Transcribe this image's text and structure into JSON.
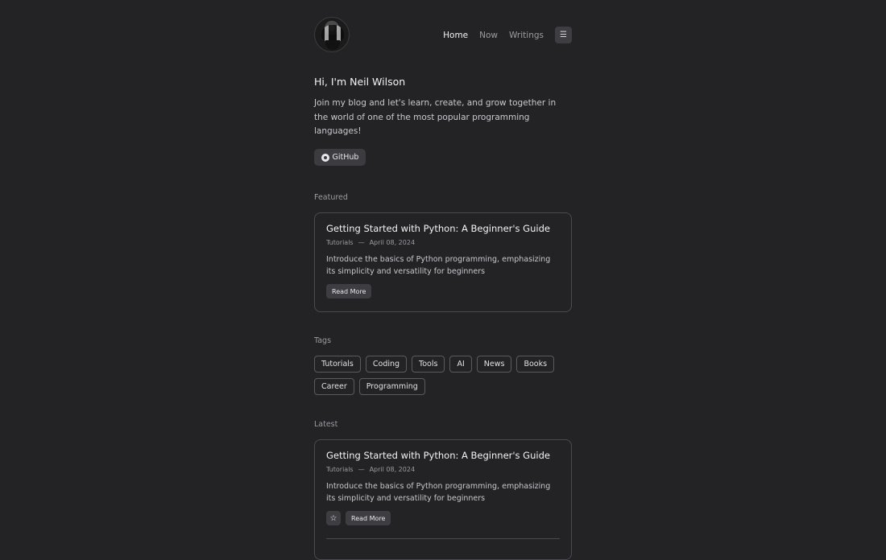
{
  "header": {
    "nav": [
      "Home",
      "Now",
      "Writings"
    ],
    "active": "Home",
    "menu_icon": "menu-icon"
  },
  "intro": {
    "title": "Hi, I'm Neil Wilson",
    "text": "Join my blog and let's learn, create, and grow together in the world of one of the most popular programming languages!",
    "github_label": "GitHub"
  },
  "featured": {
    "label": "Featured",
    "card": {
      "title": "Getting Started with Python: A Beginner's Guide",
      "category": "Tutorials",
      "sep": "—",
      "date": "April 08, 2024",
      "description": "Introduce the basics of Python programming, emphasizing its simplicity and versatility for beginners",
      "button": "Read More"
    }
  },
  "tags": {
    "label": "Tags",
    "rows": [
      [
        "Tutorials",
        "Coding",
        "Tools",
        "AI",
        "News",
        "Books"
      ],
      [
        "Career",
        "Programming"
      ]
    ]
  },
  "latest": {
    "label": "Latest",
    "card": {
      "title": "Getting Started with Python: A Beginner's Guide",
      "category": "Tutorials",
      "sep": "—",
      "date": "April 08, 2024",
      "description": "Introduce the basics of Python programming, emphasizing its simplicity and versatility for beginners",
      "button": "Read More",
      "star_icon": "star-icon"
    }
  }
}
